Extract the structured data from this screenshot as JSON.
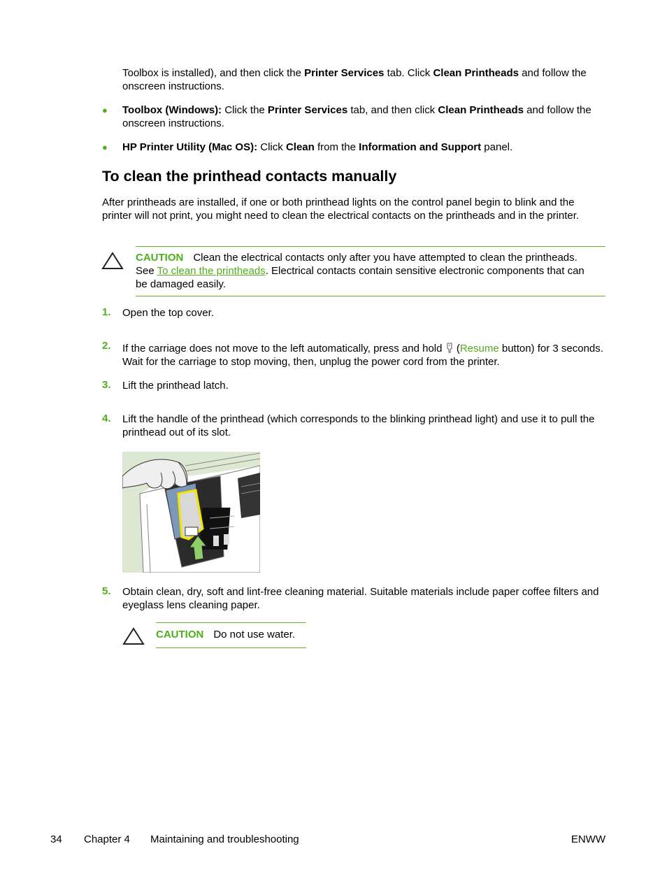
{
  "continuation": {
    "parts": [
      {
        "t": "Toolbox is installed), and then click the ",
        "b": false
      },
      {
        "t": "Printer Services",
        "b": true
      },
      {
        "t": " tab. Click ",
        "b": false
      },
      {
        "t": "Clean Printheads",
        "b": true
      },
      {
        "t": " and follow the onscreen instructions.",
        "b": false
      }
    ]
  },
  "bullets": [
    {
      "parts": [
        {
          "t": "Toolbox (Windows):",
          "b": true
        },
        {
          "t": " Click the ",
          "b": false
        },
        {
          "t": "Printer Services",
          "b": true
        },
        {
          "t": " tab, and then click ",
          "b": false
        },
        {
          "t": "Clean Printheads",
          "b": true
        },
        {
          "t": " and follow the onscreen instructions.",
          "b": false
        }
      ]
    },
    {
      "parts": [
        {
          "t": "HP Printer Utility (Mac OS):",
          "b": true
        },
        {
          "t": " Click ",
          "b": false
        },
        {
          "t": "Clean",
          "b": true
        },
        {
          "t": " from the ",
          "b": false
        },
        {
          "t": "Information and Support",
          "b": true
        },
        {
          "t": " panel.",
          "b": false
        }
      ]
    }
  ],
  "bullet_glyph": "●",
  "section": {
    "title": "To clean the printhead contacts manually",
    "intro": "After printheads are installed, if one or both printhead lights on the control panel begin to blink and the printer will not print, you might need to clean the electrical contacts on the printheads and in the printer."
  },
  "caution1": {
    "label": "CAUTION",
    "text_before": "Clean the electrical contacts only after you have attempted to clean the printheads. See ",
    "link": "To clean the printheads",
    "text_after": ". Electrical contacts contain sensitive electronic components that can be damaged easily."
  },
  "steps": [
    {
      "num": "1.",
      "text": "Open the top cover."
    },
    {
      "num": "2.",
      "text_before": "If the carriage does not move to the left automatically, press and hold ",
      "icon": "resume-button-icon",
      "paren_open": " (",
      "link": "Resume",
      "text_after": " button) for 3 seconds. Wait for the carriage to stop moving, then, unplug the power cord from the printer."
    },
    {
      "num": "3.",
      "text": "Lift the printhead latch."
    },
    {
      "num": "4.",
      "text": "Lift the handle of the printhead (which corresponds to the blinking printhead light) and use it to pull the printhead out of its slot."
    },
    {
      "num": "5.",
      "text": "Obtain clean, dry, soft and lint-free cleaning material. Suitable materials include paper coffee filters and eyeglass lens cleaning paper."
    }
  ],
  "caution2": {
    "label": "CAUTION",
    "text": "Do not use water."
  },
  "figure": {
    "description": "Hand lifting printhead out of its slot, with green up arrow"
  },
  "footer": {
    "page": "34",
    "chapter": "Chapter 4",
    "chapter_title": "Maintaining and troubleshooting",
    "locale": "ENWW"
  },
  "colors": {
    "accent": "#4fae1a",
    "rule": "#66b32e"
  }
}
